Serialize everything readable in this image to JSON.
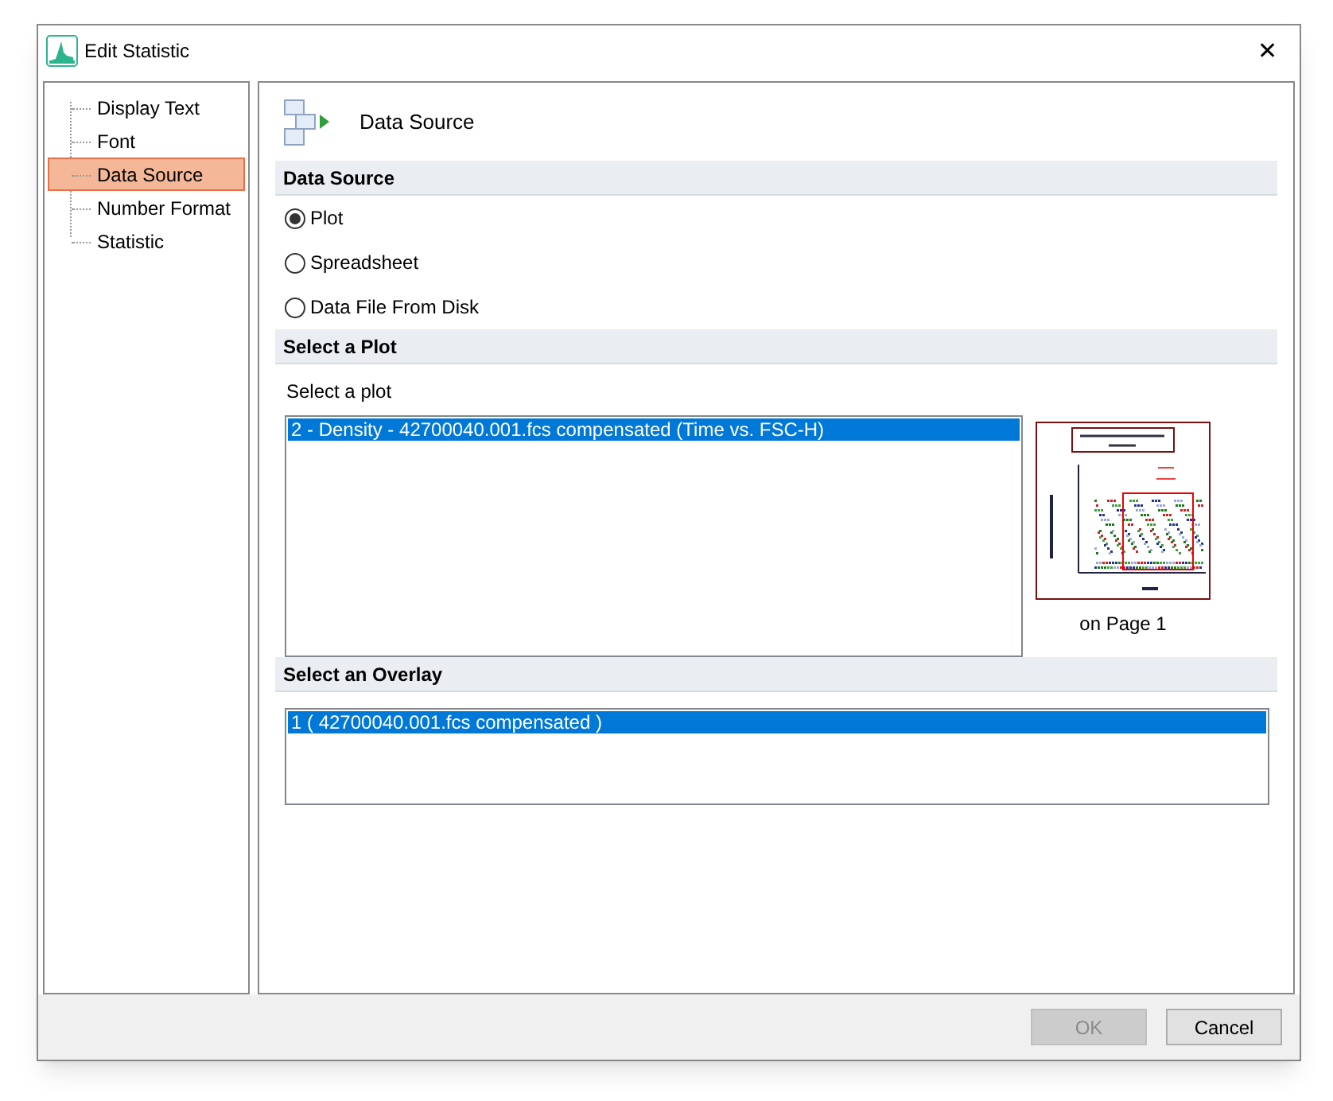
{
  "window": {
    "title": "Edit Statistic",
    "close": "✕"
  },
  "sidebar": {
    "items": [
      {
        "label": "Display Text",
        "selected": false
      },
      {
        "label": "Font",
        "selected": false
      },
      {
        "label": "Data Source",
        "selected": true
      },
      {
        "label": "Number Format",
        "selected": false
      },
      {
        "label": "Statistic",
        "selected": false
      }
    ]
  },
  "page_title": "Data Source",
  "sections": [
    {
      "kind": "radios",
      "title": "Data Source",
      "options": [
        {
          "label": "Plot",
          "selected": true
        },
        {
          "label": "Spreadsheet",
          "selected": false
        },
        {
          "label": "Data File From Disk",
          "selected": false
        }
      ]
    },
    {
      "kind": "plot",
      "title": "Select a Plot",
      "label": "Select a plot",
      "items": [
        {
          "label": "2 - Density - 42700040.001.fcs compensated (Time vs. FSC-H)",
          "selected": true
        }
      ],
      "caption": "on Page 1"
    },
    {
      "kind": "list",
      "title": "Select an Overlay",
      "items": [
        {
          "label": "1 ( 42700040.001.fcs compensated )",
          "selected": true
        }
      ]
    }
  ],
  "buttons": [
    {
      "label": "OK",
      "disabled": true
    },
    {
      "label": "Cancel",
      "disabled": false
    }
  ]
}
